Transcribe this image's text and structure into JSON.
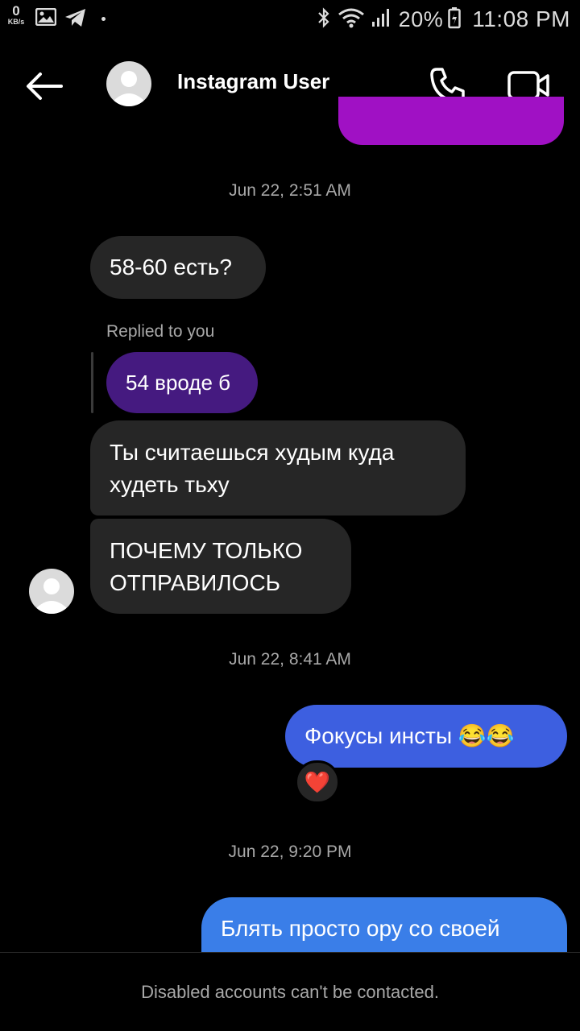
{
  "status_bar": {
    "net_speed_value": "0",
    "net_speed_unit": "KB/s",
    "battery_percent": "20%",
    "time": "11:08 PM"
  },
  "header": {
    "contact_name": "Instagram User"
  },
  "messages": {
    "timestamp_1": "Jun 22, 2:51 AM",
    "m1": "58-60 есть?",
    "replied_label": "Replied to you",
    "reply_quote": "54 вроде б",
    "m2": "Ты считаешься худым куда худеть тьху",
    "m3": "ПОЧЕМУ ТОЛЬКО ОТПРАВИЛОСЬ",
    "timestamp_2": "Jun 22, 8:41 AM",
    "m4": "Фокусы инсты 😂😂",
    "reaction": "❤️",
    "timestamp_3": "Jun 22, 9:20 PM",
    "m5": "Блять просто ору со своей"
  },
  "footer": {
    "notice": "Disabled accounts can't be contacted."
  },
  "colors": {
    "background": "#000000",
    "incoming_bubble": "#262626",
    "outgoing_bubble_blue": "#3d5fe0",
    "outgoing_bubble_purple": "#a011c4",
    "reply_bubble": "#451a80"
  }
}
